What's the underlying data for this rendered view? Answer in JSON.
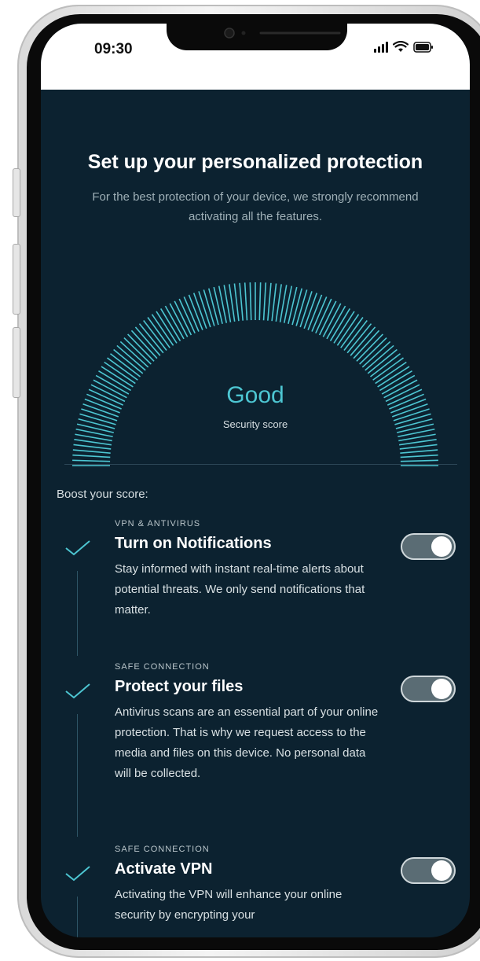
{
  "status_bar": {
    "time": "09:30"
  },
  "header": {
    "title": "Set up your personalized protection",
    "subtitle": "For the best protection of your device, we strongly recommend activating all the features."
  },
  "score": {
    "value": "Good",
    "label": "Security score",
    "color": "#4dc6d2"
  },
  "boost_label": "Boost your score:",
  "items": [
    {
      "category": "VPN & ANTIVIRUS",
      "title": "Turn on Notifications",
      "description": "Stay informed with instant real-time alerts about potential threats. We only send notifications that matter.",
      "enabled": true
    },
    {
      "category": "SAFE CONNECTION",
      "title": "Protect your files",
      "description": "Antivirus scans are an essential part of your online protection. That is why we request access to the media and files on this device. No personal data will be collected.",
      "enabled": true
    },
    {
      "category": "SAFE CONNECTION",
      "title": "Activate VPN",
      "description": "Activating the VPN will enhance your online security by encrypting your",
      "enabled": true
    }
  ],
  "colors": {
    "background": "#0c2230",
    "accent": "#4dc6d2",
    "toggle_track": "#5a6c74"
  },
  "icons": [
    "check-icon",
    "signal-icon",
    "wifi-icon",
    "battery-icon",
    "camera-icon"
  ]
}
